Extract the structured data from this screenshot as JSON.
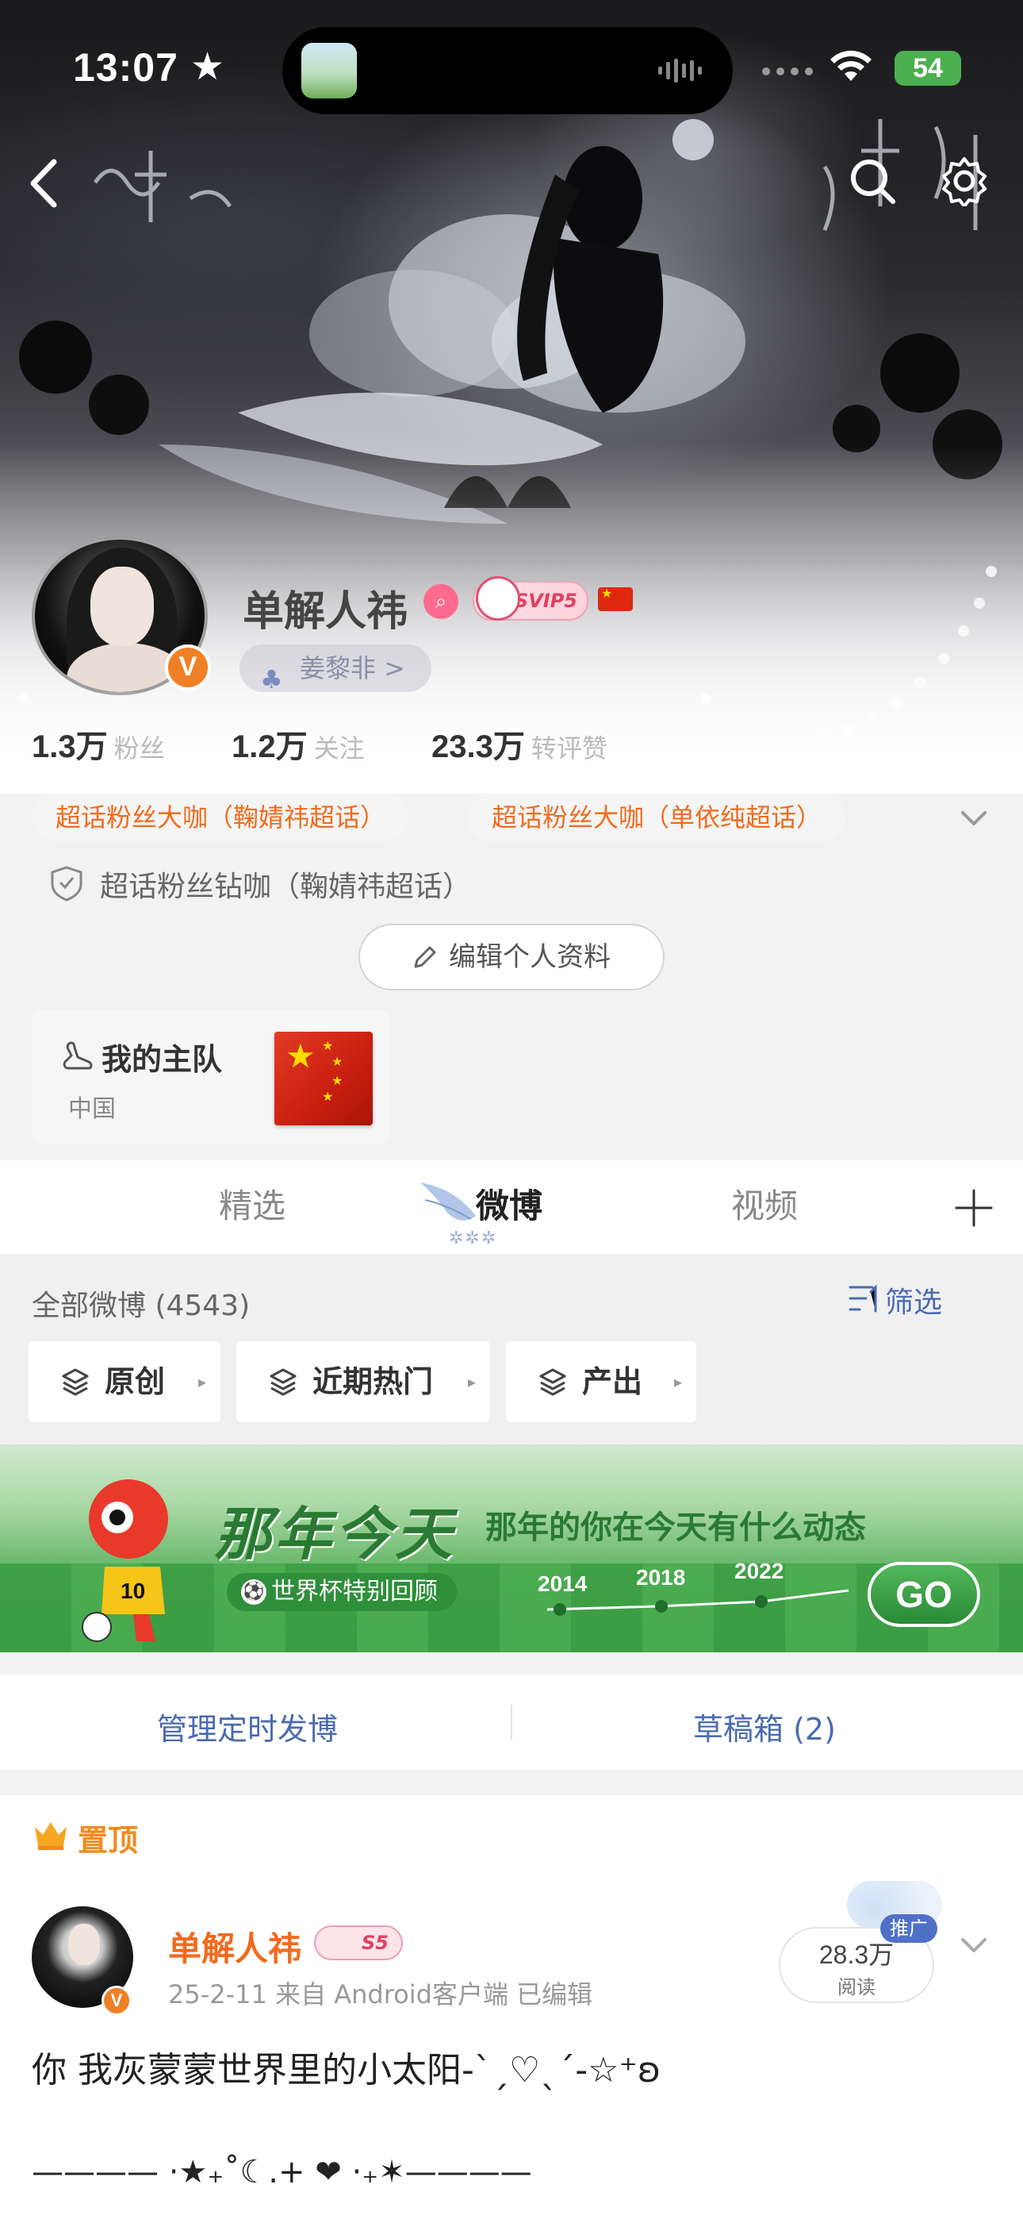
{
  "status_bar": {
    "time": "13:07",
    "battery": "54"
  },
  "profile": {
    "username": "单解人祎",
    "svip_label": "SVIP5",
    "follow_chip": "姜黎非 >",
    "verified_badge": "V",
    "stats": [
      {
        "value": "1.3万",
        "label": "粉丝"
      },
      {
        "value": "1.2万",
        "label": "关注"
      },
      {
        "value": "23.3万",
        "label": "转评赞"
      }
    ],
    "tags": [
      "超话粉丝大咖（鞠婧祎超话）",
      "超话粉丝大咖（单依纯超话）"
    ],
    "diamond_tag": "超话粉丝钻咖（鞠婧祎超话）",
    "edit_button": "编辑个人资料"
  },
  "team_card": {
    "title": "我的主队",
    "country": "中国"
  },
  "tabs": [
    {
      "label": "精选",
      "active": false
    },
    {
      "label": "微博",
      "active": true
    },
    {
      "label": "视频",
      "active": false
    }
  ],
  "filter": {
    "all_posts": "全部微博 (4543)",
    "filter_label": "筛选",
    "buttons": [
      "原创",
      "近期热门",
      "产出"
    ]
  },
  "promo": {
    "title": "那年今天",
    "subtitle": "那年的你在今天有什么动态",
    "pill": "世界杯特别回顾",
    "years": [
      "2014",
      "2018",
      "2022"
    ],
    "go": "GO",
    "jersey_number": "10"
  },
  "manage": {
    "left": "管理定时发博",
    "right": "草稿箱 (2)"
  },
  "post": {
    "pin_label": "置顶",
    "author": "单解人祎",
    "author_level": "S5",
    "meta": "25-2-11  来自 Android客户端  已编辑",
    "reads": "28.3万",
    "reads_label": "阅读",
    "promo_tag": "推广",
    "text": "你 我灰蒙蒙世界里的小太阳-ˋˏ♡ˎˊ-☆⁺ʚ",
    "line2": "———— ·★₊˚☾.+ ❤ ·₊✶————"
  },
  "colors": {
    "accent_orange": "#f26b1d",
    "link_blue": "#4a6bb2",
    "battery_green": "#4caf50",
    "verified_orange": "#f08026"
  }
}
